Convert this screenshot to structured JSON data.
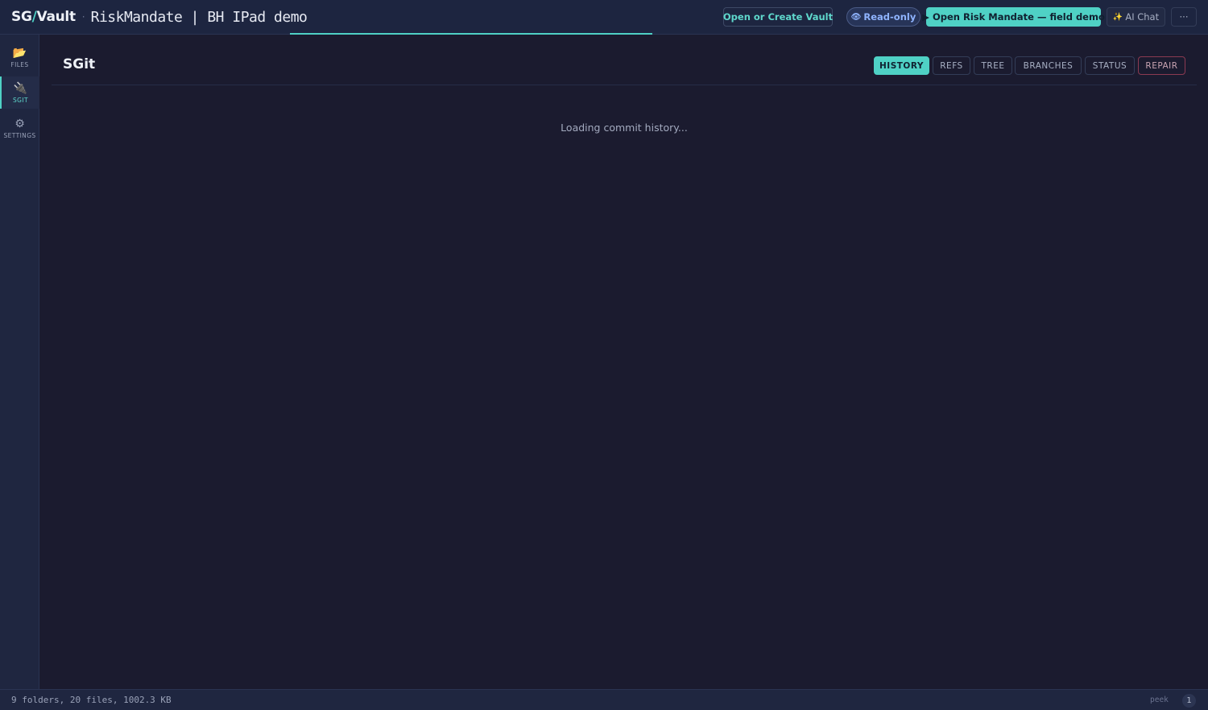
{
  "app": {
    "brand_prefix": "SG",
    "brand_slash": "/",
    "brand_suffix": "Vault",
    "separator": "·",
    "vault_title": "RiskMandate | BH IPad demo"
  },
  "toolbar": {
    "open_vault_label": "Open or Create Vault",
    "readonly_icon": "👁",
    "readonly_label": "Read-only",
    "open_demo_label": "▶ Open Risk Mandate — field demo",
    "ai_chat_icon": "✨",
    "ai_chat_label": "AI Chat",
    "more_label": "···"
  },
  "sidebar": {
    "items": [
      {
        "icon": "📂",
        "icon_name": "folder-icon",
        "label": "FILES"
      },
      {
        "icon": "🔌",
        "icon_name": "plug-icon",
        "label": "SGIT"
      },
      {
        "icon": "⚙",
        "icon_name": "gear-icon",
        "label": "SETTINGS"
      }
    ]
  },
  "main": {
    "title": "SGit",
    "tabs": [
      {
        "label": "HISTORY"
      },
      {
        "label": "REFS"
      },
      {
        "label": "TREE"
      },
      {
        "label": "BRANCHES"
      },
      {
        "label": "STATUS"
      },
      {
        "label": "REPAIR"
      }
    ],
    "loading_text": "Loading commit history..."
  },
  "statusbar": {
    "summary": "9 folders, 20 files, 1002.3 KB",
    "peek_label": "peek",
    "badge_count": "1"
  },
  "colors": {
    "accent": "#4fd1c5",
    "background": "#1b1b2f",
    "topbar": "#1d2540",
    "danger_border": "#8c3a52"
  }
}
